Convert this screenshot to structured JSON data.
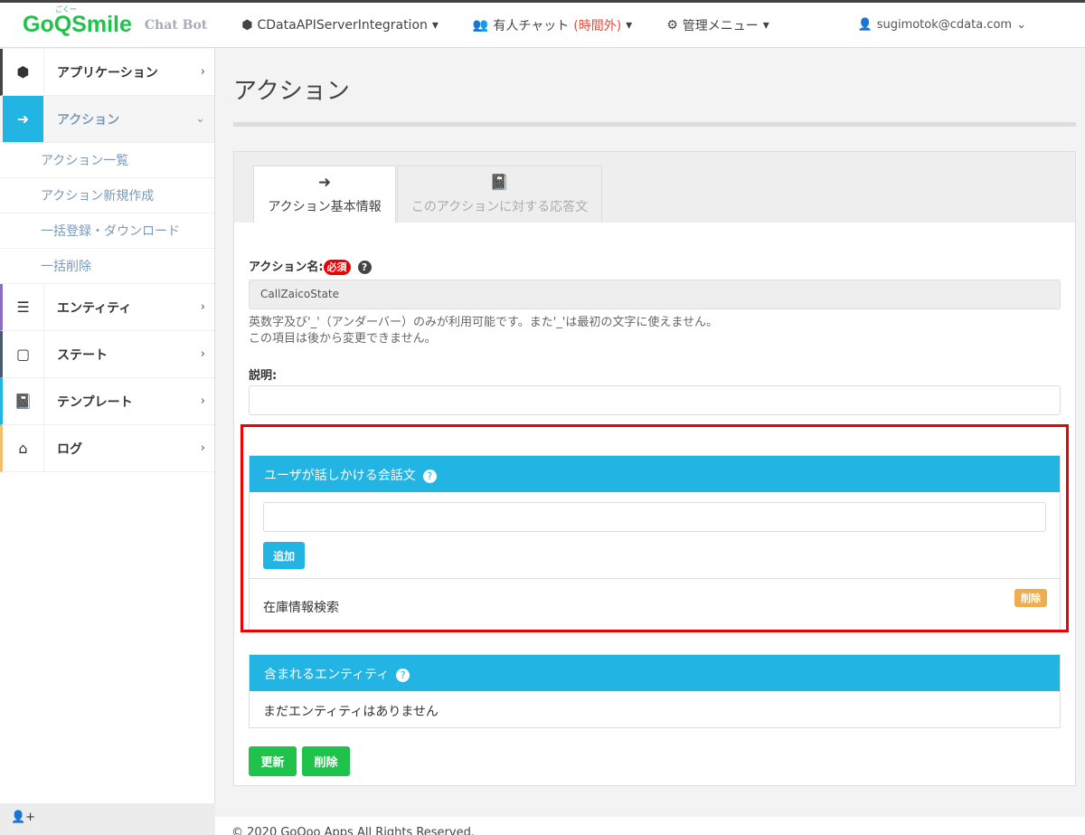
{
  "nav": {
    "logo": "GoQSmile",
    "logo_ruby": "ごくー",
    "subtitle": "Chat Bot",
    "project": "CDataAPIServerIntegration",
    "chat": "有人チャット",
    "chat_status": "(時間外)",
    "admin": "管理メニュー",
    "user": "sugimotok@cdata.com"
  },
  "sidebar": {
    "items": [
      {
        "label": "アプリケーション",
        "icon": "cube-icon",
        "color": "#444444"
      },
      {
        "label": "アクション",
        "icon": "arrow-circle-icon",
        "color": "#22b5e3"
      },
      {
        "label": "エンティティ",
        "icon": "list-icon",
        "color": "#8a6fc1"
      },
      {
        "label": "ステート",
        "icon": "square-icon",
        "color": "#4a5a6a"
      },
      {
        "label": "テンプレート",
        "icon": "book-icon",
        "color": "#22b5e3"
      },
      {
        "label": "ログ",
        "icon": "inbox-icon",
        "color": "#f0c070"
      }
    ],
    "subitems": [
      "アクション一覧",
      "アクション新規作成",
      "一括登録・ダウンロード",
      "一括削除"
    ]
  },
  "page": {
    "title": "アクション",
    "tabs": [
      "アクション基本情報",
      "このアクションに対する応答文"
    ],
    "name_label": "アクション名:",
    "required": "必須",
    "name_value": "CallZaicoState",
    "help1": "英数字及び'_'（アンダーバー）のみが利用可能です。また'_'は最初の文字に使えません。",
    "help2": "この項目は後から変更できません。",
    "desc_label": "説明:",
    "desc_value": "",
    "utter_header": "ユーザが話しかける会話文",
    "utter_input": "",
    "add": "追加",
    "utterances": [
      {
        "text": "在庫情報検索",
        "delete": "削除"
      }
    ],
    "entity_header": "含まれるエンティティ",
    "entity_empty": "まだエンティティはありません",
    "update": "更新",
    "delete": "削除"
  },
  "footer": "© 2020 GoQoo Apps All Rights Reserved."
}
